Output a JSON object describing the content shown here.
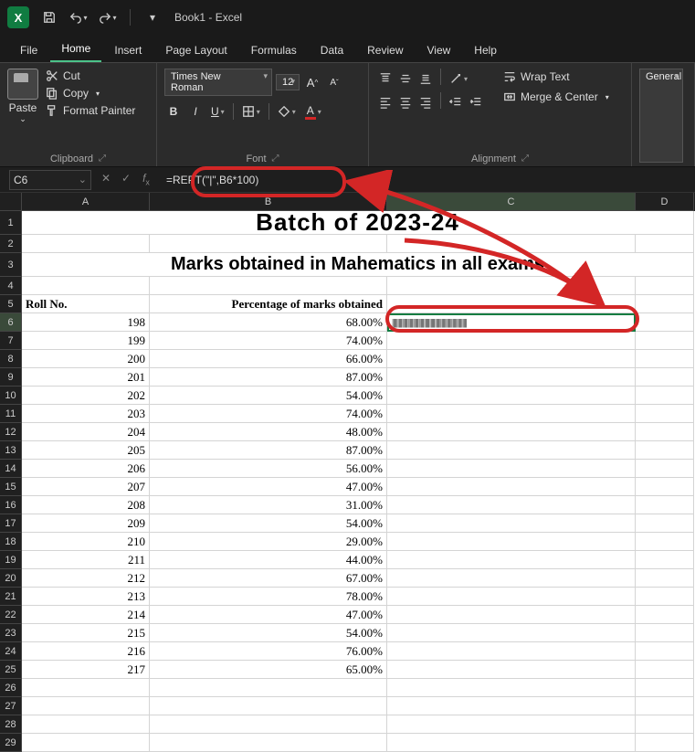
{
  "titlebar": {
    "app_icon_letter": "X",
    "title": "Book1 - Excel"
  },
  "tabs": [
    "File",
    "Home",
    "Insert",
    "Page Layout",
    "Formulas",
    "Data",
    "Review",
    "View",
    "Help"
  ],
  "active_tab": "Home",
  "ribbon": {
    "clipboard": {
      "paste": "Paste",
      "cut": "Cut",
      "copy": "Copy",
      "format_painter": "Format Painter",
      "label": "Clipboard"
    },
    "font": {
      "name": "Times New Roman",
      "size": "12",
      "bold": "B",
      "italic": "I",
      "underline": "U",
      "label": "Font",
      "grow": "A",
      "shrink": "A"
    },
    "alignment": {
      "wrap": "Wrap Text",
      "merge": "Merge & Center",
      "label": "Alignment"
    },
    "number": {
      "format": "General"
    }
  },
  "formula_bar": {
    "name_box": "C6",
    "formula": "=REPT(\"|\",B6*100)"
  },
  "columns": [
    "A",
    "B",
    "C",
    "D"
  ],
  "sheet": {
    "title1": "Batch of 2023-24",
    "title2": "Marks obtained in Mahematics in all exams",
    "header_a": "Roll No.",
    "header_b": "Percentage of marks obtained",
    "c6_display": "||||||||||||||||||||||||||||||||||||||||||||||||||||||||||||||||||||",
    "rows": [
      {
        "r": 198,
        "p": "68.00%"
      },
      {
        "r": 199,
        "p": "74.00%"
      },
      {
        "r": 200,
        "p": "66.00%"
      },
      {
        "r": 201,
        "p": "87.00%"
      },
      {
        "r": 202,
        "p": "54.00%"
      },
      {
        "r": 203,
        "p": "74.00%"
      },
      {
        "r": 204,
        "p": "48.00%"
      },
      {
        "r": 205,
        "p": "87.00%"
      },
      {
        "r": 206,
        "p": "56.00%"
      },
      {
        "r": 207,
        "p": "47.00%"
      },
      {
        "r": 208,
        "p": "31.00%"
      },
      {
        "r": 209,
        "p": "54.00%"
      },
      {
        "r": 210,
        "p": "29.00%"
      },
      {
        "r": 211,
        "p": "44.00%"
      },
      {
        "r": 212,
        "p": "67.00%"
      },
      {
        "r": 213,
        "p": "78.00%"
      },
      {
        "r": 214,
        "p": "47.00%"
      },
      {
        "r": 215,
        "p": "54.00%"
      },
      {
        "r": 216,
        "p": "76.00%"
      },
      {
        "r": 217,
        "p": "65.00%"
      }
    ]
  },
  "chart_data": {
    "type": "table",
    "title": "Batch of 2023-24 — Marks obtained in Mahematics in all exams",
    "columns": [
      "Roll No.",
      "Percentage of marks obtained"
    ],
    "rows": [
      [
        198,
        0.68
      ],
      [
        199,
        0.74
      ],
      [
        200,
        0.66
      ],
      [
        201,
        0.87
      ],
      [
        202,
        0.54
      ],
      [
        203,
        0.74
      ],
      [
        204,
        0.48
      ],
      [
        205,
        0.87
      ],
      [
        206,
        0.56
      ],
      [
        207,
        0.47
      ],
      [
        208,
        0.31
      ],
      [
        209,
        0.54
      ],
      [
        210,
        0.29
      ],
      [
        211,
        0.44
      ],
      [
        212,
        0.67
      ],
      [
        213,
        0.78
      ],
      [
        214,
        0.47
      ],
      [
        215,
        0.54
      ],
      [
        216,
        0.76
      ],
      [
        217,
        0.65
      ]
    ]
  }
}
